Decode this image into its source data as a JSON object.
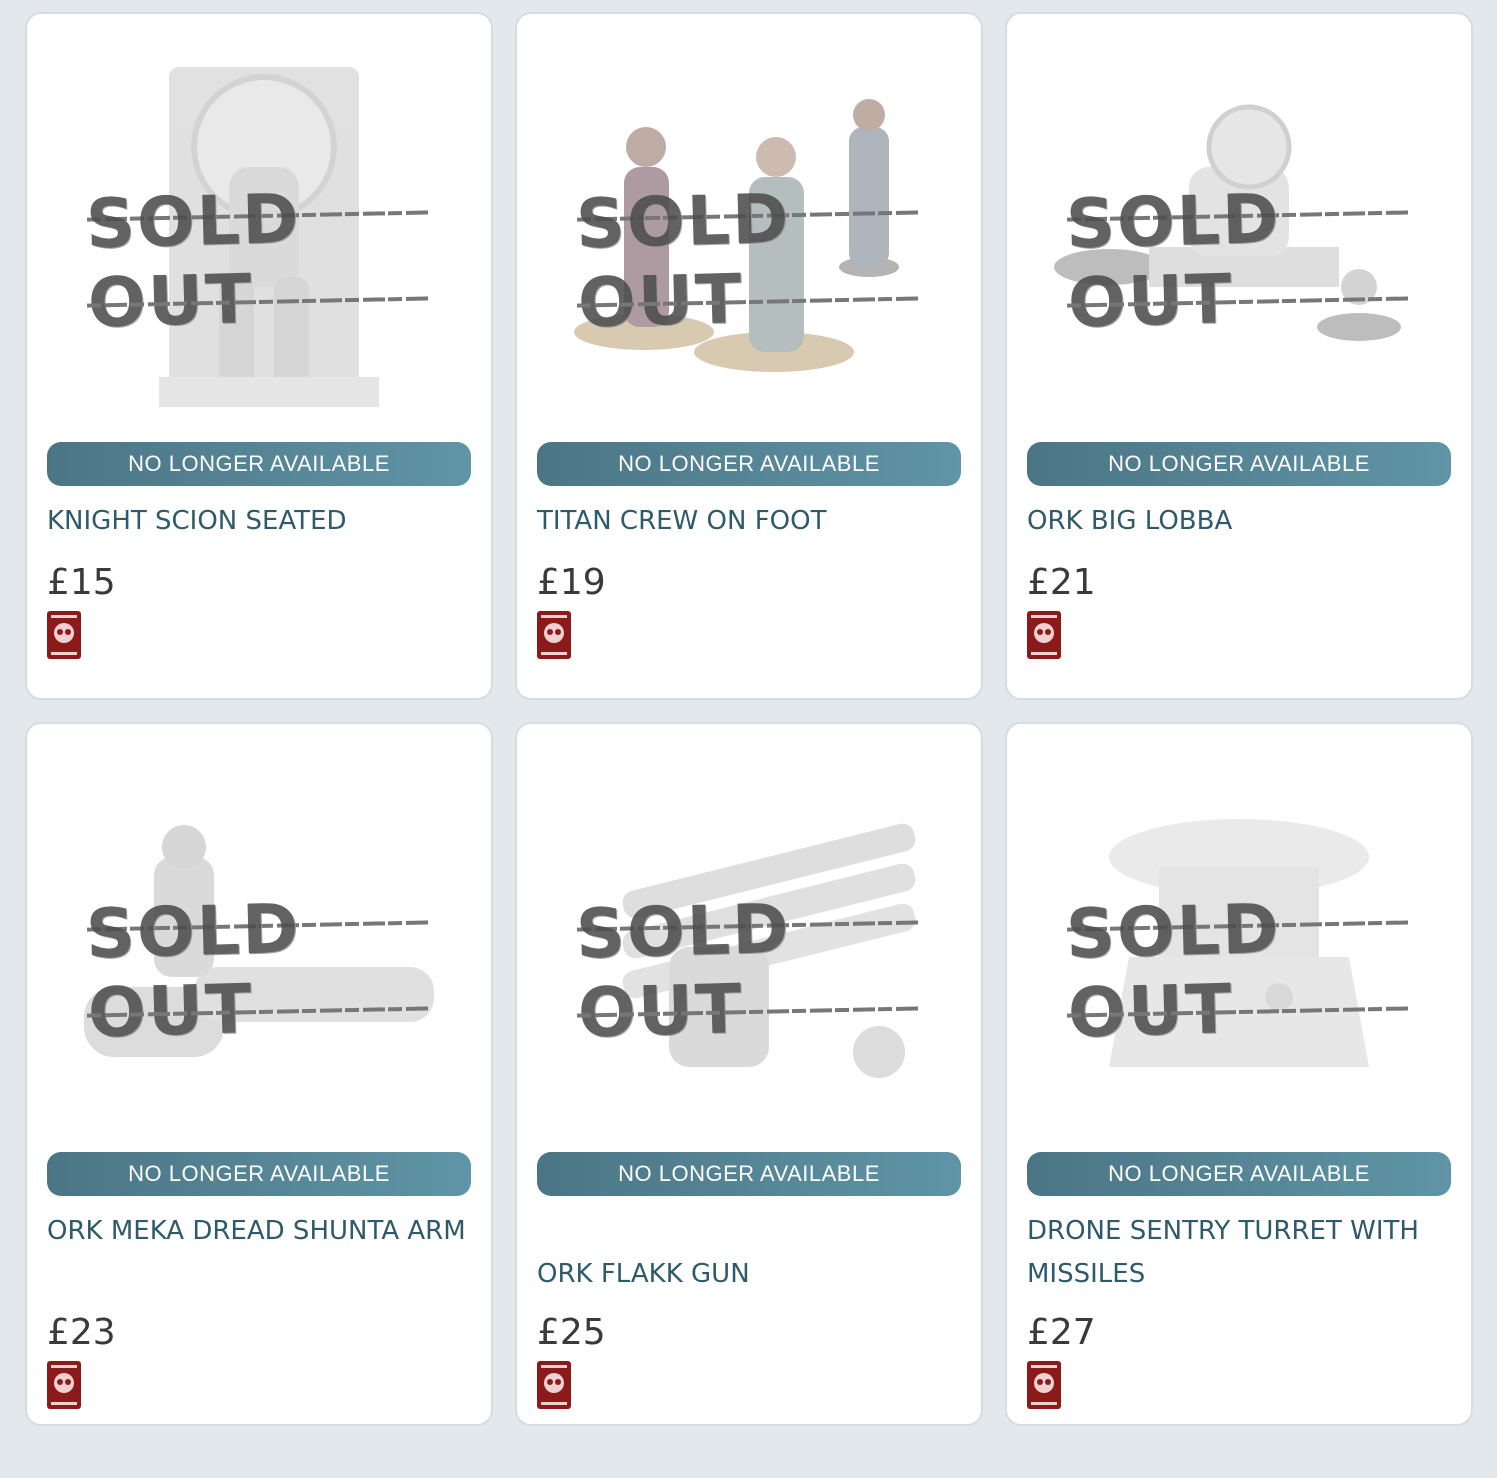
{
  "colors": {
    "background": "#e3e8ec",
    "badge": "#5385a0",
    "title": "#2e5a6b",
    "logo": "#8b1a1a"
  },
  "products": [
    {
      "title": "KNIGHT SCION SEATED",
      "price": "£15",
      "badge": "NO LONGER AVAILABLE",
      "overlay": "SOLD OUT",
      "icon": "seated-knight-miniature-icon",
      "logo_icon": "skull-emblem-icon"
    },
    {
      "title": "TITAN CREW ON FOOT",
      "price": "£19",
      "badge": "NO LONGER AVAILABLE",
      "overlay": "SOLD OUT",
      "icon": "crew-figures-miniature-icon",
      "logo_icon": "skull-emblem-icon"
    },
    {
      "title": "ORK BIG LOBBA",
      "price": "£21",
      "badge": "NO LONGER AVAILABLE",
      "overlay": "SOLD OUT",
      "icon": "artillery-miniature-icon",
      "logo_icon": "skull-emblem-icon"
    },
    {
      "title": "ORK MEKA DREAD SHUNTA ARM",
      "price": "£23",
      "badge": "NO LONGER AVAILABLE",
      "overlay": "SOLD OUT",
      "icon": "mech-arm-miniature-icon",
      "logo_icon": "skull-emblem-icon"
    },
    {
      "title": "ORK FLAKK GUN",
      "price": "£25",
      "badge": "NO LONGER AVAILABLE",
      "overlay": "SOLD OUT",
      "icon": "flak-gun-miniature-icon",
      "logo_icon": "skull-emblem-icon"
    },
    {
      "title": "DRONE SENTRY TURRET WITH MISSILES",
      "price": "£27",
      "badge": "NO LONGER AVAILABLE",
      "overlay": "SOLD OUT",
      "icon": "turret-miniature-icon",
      "logo_icon": "skull-emblem-icon"
    }
  ]
}
